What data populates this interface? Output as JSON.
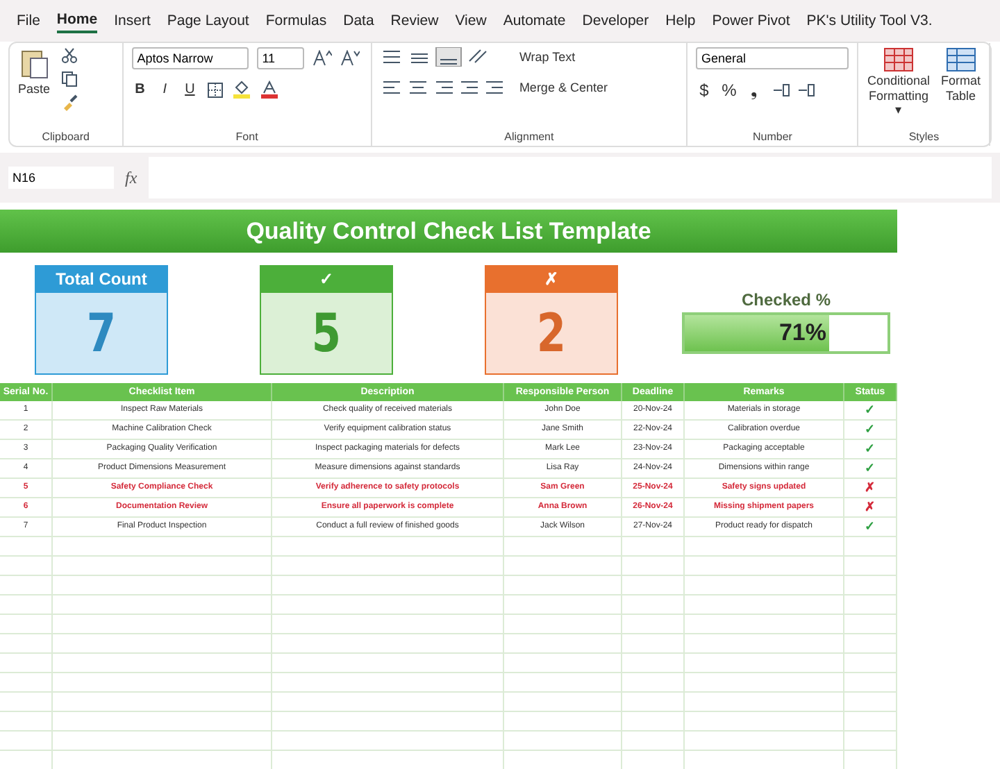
{
  "menu_tabs": [
    {
      "label": "File",
      "selected": false
    },
    {
      "label": "Home",
      "selected": true
    },
    {
      "label": "Insert",
      "selected": false
    },
    {
      "label": "Page Layout",
      "selected": false
    },
    {
      "label": "Formulas",
      "selected": false
    },
    {
      "label": "Data",
      "selected": false
    },
    {
      "label": "Review",
      "selected": false
    },
    {
      "label": "View",
      "selected": false
    },
    {
      "label": "Automate",
      "selected": false
    },
    {
      "label": "Developer",
      "selected": false
    },
    {
      "label": "Help",
      "selected": false
    },
    {
      "label": "Power Pivot",
      "selected": false
    },
    {
      "label": "PK's Utility Tool V3.",
      "selected": false
    }
  ],
  "ribbon": {
    "paste": "Paste",
    "font_name": "Aptos Narrow",
    "font_size": "11",
    "bold": "B",
    "italic": "I",
    "underline": "U",
    "wrap_text": "Wrap Text",
    "merge_center": "Merge & Center",
    "number_format": "General",
    "currency": "$",
    "percent": "%",
    "comma": "❟",
    "conditional_formatting": [
      "Conditional",
      "Formatting ▾"
    ],
    "format_table": [
      "Format",
      "Table"
    ],
    "groups": [
      "Clipboard",
      "Font",
      "Alignment",
      "Number",
      "Styles"
    ]
  },
  "formula_bar": {
    "name_box": "N16",
    "fx": "fx"
  },
  "title": "Quality Control Check List Template",
  "cards": [
    {
      "header": "Total Count",
      "value": "7",
      "color": "#2e9bd6"
    },
    {
      "header": "✓",
      "value": "5",
      "color": "#4caf3a"
    },
    {
      "header": "✗",
      "value": "2",
      "color": "#e8702e"
    }
  ],
  "progress": {
    "label": "Checked %",
    "level": 0.71,
    "reading": "71%"
  },
  "table": {
    "columns": [
      "Serial No.",
      "Checklist Item",
      "Description",
      "Responsible Person",
      "Deadline",
      "Remarks",
      "Status"
    ],
    "rows": [
      {
        "passed": true,
        "cells": [
          "1",
          "Inspect Raw Materials",
          "Check quality of received materials",
          "John Doe",
          "20-Nov-24",
          "Materials in storage"
        ],
        "status": "✓"
      },
      {
        "passed": true,
        "cells": [
          "2",
          "Machine Calibration Check",
          "Verify equipment calibration status",
          "Jane Smith",
          "22-Nov-24",
          "Calibration overdue"
        ],
        "status": "✓"
      },
      {
        "passed": true,
        "cells": [
          "3",
          "Packaging Quality Verification",
          "Inspect packaging materials for defects",
          "Mark Lee",
          "23-Nov-24",
          "Packaging acceptable"
        ],
        "status": "✓"
      },
      {
        "passed": true,
        "cells": [
          "4",
          "Product Dimensions Measurement",
          "Measure dimensions against standards",
          "Lisa Ray",
          "24-Nov-24",
          "Dimensions within range"
        ],
        "status": "✓"
      },
      {
        "passed": false,
        "cells": [
          "5",
          "Safety Compliance Check",
          "Verify adherence to safety protocols",
          "Sam Green",
          "25-Nov-24",
          "Safety signs updated"
        ],
        "status": "✗"
      },
      {
        "passed": false,
        "cells": [
          "6",
          "Documentation Review",
          "Ensure all paperwork is complete",
          "Anna Brown",
          "26-Nov-24",
          "Missing shipment papers"
        ],
        "status": "✗"
      },
      {
        "passed": true,
        "cells": [
          "7",
          "Final Product Inspection",
          "Conduct a full review of finished goods",
          "Jack Wilson",
          "27-Nov-24",
          "Product ready for dispatch"
        ],
        "status": "✓"
      }
    ]
  }
}
